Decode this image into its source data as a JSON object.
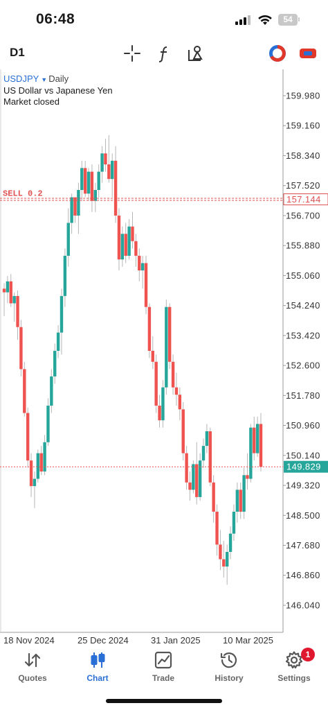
{
  "status_bar": {
    "time": "06:48",
    "battery": "54"
  },
  "toolbar": {
    "timeframe": "D1"
  },
  "chart_info": {
    "symbol": "USDJPY",
    "period": "Daily",
    "description": "US Dollar vs Japanese Yen",
    "market_status": "Market closed"
  },
  "order_line": {
    "label": "SELL 0.2",
    "price": "157.144",
    "value": 157.144
  },
  "current_price": {
    "label": "149.829",
    "value": 149.829
  },
  "bottom_nav": [
    {
      "label": "Quotes",
      "icon": "quotes-arrows-icon"
    },
    {
      "label": "Chart",
      "icon": "candlestick-icon",
      "active": true
    },
    {
      "label": "Trade",
      "icon": "trade-chart-icon"
    },
    {
      "label": "History",
      "icon": "history-clock-icon"
    },
    {
      "label": "Settings",
      "icon": "gear-icon",
      "badge": "1"
    }
  ],
  "colors": {
    "bull": "#26a69a",
    "bear": "#ef5350",
    "accent": "#2a6fd6",
    "order_line": "#e05252",
    "badge": "#e0182f"
  },
  "chart_data": {
    "type": "candlestick",
    "symbol": "USDJPY",
    "timeframe": "Daily",
    "y_ticks": [
      159.98,
      159.16,
      158.34,
      157.52,
      156.7,
      155.88,
      155.06,
      154.24,
      153.42,
      152.6,
      151.78,
      150.96,
      150.14,
      149.32,
      148.5,
      147.68,
      146.86,
      146.04
    ],
    "y_tick_labels": [
      "159.980",
      "159.160",
      "158.340",
      "157.520",
      "156.700",
      "155.880",
      "155.060",
      "154.240",
      "153.420",
      "152.600",
      "151.780",
      "150.960",
      "150.140",
      "149.320",
      "148.500",
      "147.680",
      "146.860",
      "146.040"
    ],
    "x_tick_labels": [
      "18 Nov 2024",
      "25 Dec 2024",
      "31 Jan 2025",
      "10 Mar 2025"
    ],
    "y_range": [
      145.3,
      160.7
    ],
    "candles": [
      [
        154.7,
        154.85,
        153.95,
        154.6
      ],
      [
        154.6,
        155.05,
        154.3,
        154.9
      ],
      [
        154.9,
        155.1,
        154.2,
        154.3
      ],
      [
        154.3,
        154.6,
        153.8,
        154.5
      ],
      [
        154.5,
        154.65,
        153.3,
        153.65
      ],
      [
        153.65,
        153.85,
        152.3,
        152.5
      ],
      [
        152.5,
        152.7,
        151.2,
        151.3
      ],
      [
        151.3,
        151.45,
        149.8,
        150.0
      ],
      [
        150.0,
        150.2,
        149.0,
        149.3
      ],
      [
        149.3,
        149.7,
        148.7,
        149.5
      ],
      [
        149.5,
        150.3,
        149.4,
        150.2
      ],
      [
        150.2,
        150.4,
        149.6,
        149.7
      ],
      [
        149.7,
        150.7,
        149.6,
        150.5
      ],
      [
        150.5,
        151.7,
        150.4,
        151.5
      ],
      [
        151.5,
        152.5,
        151.3,
        152.3
      ],
      [
        152.3,
        153.2,
        152.1,
        153.0
      ],
      [
        153.0,
        153.7,
        152.8,
        153.5
      ],
      [
        153.5,
        154.7,
        152.9,
        154.5
      ],
      [
        154.5,
        155.8,
        154.2,
        155.6
      ],
      [
        155.6,
        156.9,
        155.3,
        156.5
      ],
      [
        156.5,
        157.3,
        156.2,
        157.2
      ],
      [
        157.2,
        157.2,
        156.5,
        156.7
      ],
      [
        156.7,
        157.6,
        156.2,
        157.4
      ],
      [
        157.4,
        158.2,
        157.1,
        158.0
      ],
      [
        158.0,
        158.2,
        157.2,
        157.3
      ],
      [
        157.3,
        158.0,
        157.1,
        157.9
      ],
      [
        157.9,
        158.1,
        156.8,
        157.1
      ],
      [
        157.1,
        157.6,
        156.8,
        157.4
      ],
      [
        157.4,
        158.1,
        157.2,
        157.9
      ],
      [
        157.9,
        158.6,
        157.6,
        158.4
      ],
      [
        158.4,
        158.8,
        157.9,
        158.1
      ],
      [
        158.1,
        158.9,
        157.6,
        157.7
      ],
      [
        157.7,
        158.4,
        157.2,
        158.2
      ],
      [
        158.2,
        158.6,
        156.5,
        156.7
      ],
      [
        156.7,
        156.9,
        155.2,
        155.5
      ],
      [
        155.5,
        156.4,
        155.3,
        156.2
      ],
      [
        156.2,
        156.5,
        155.4,
        155.6
      ],
      [
        155.6,
        156.6,
        155.5,
        156.4
      ],
      [
        156.4,
        156.8,
        155.8,
        156.0
      ],
      [
        156.0,
        156.2,
        155.3,
        155.6
      ],
      [
        155.6,
        155.8,
        154.9,
        155.2
      ],
      [
        155.2,
        155.6,
        154.7,
        155.4
      ],
      [
        155.4,
        155.6,
        154.0,
        154.2
      ],
      [
        154.2,
        154.3,
        152.8,
        153.0
      ],
      [
        153.0,
        153.4,
        152.5,
        152.7
      ],
      [
        152.7,
        152.9,
        151.3,
        151.5
      ],
      [
        151.5,
        151.8,
        150.9,
        151.1
      ],
      [
        151.1,
        152.2,
        150.9,
        152.0
      ],
      [
        152.0,
        154.4,
        151.8,
        154.2
      ],
      [
        154.2,
        154.3,
        152.5,
        152.7
      ],
      [
        152.7,
        152.9,
        151.8,
        152.0
      ],
      [
        152.0,
        152.4,
        151.5,
        151.8
      ],
      [
        151.8,
        152.0,
        151.1,
        151.4
      ],
      [
        151.4,
        151.6,
        150.0,
        150.2
      ],
      [
        150.2,
        150.4,
        149.2,
        149.4
      ],
      [
        149.4,
        149.7,
        148.9,
        149.2
      ],
      [
        149.2,
        150.0,
        149.1,
        149.9
      ],
      [
        149.9,
        150.5,
        148.8,
        149.0
      ],
      [
        149.0,
        150.2,
        148.9,
        150.0
      ],
      [
        150.0,
        150.6,
        149.8,
        150.4
      ],
      [
        150.4,
        151.0,
        150.2,
        150.8
      ],
      [
        150.8,
        150.9,
        149.3,
        149.4
      ],
      [
        149.4,
        149.6,
        148.3,
        148.6
      ],
      [
        148.6,
        148.8,
        147.4,
        147.7
      ],
      [
        147.7,
        148.1,
        147.0,
        147.3
      ],
      [
        147.3,
        147.8,
        146.8,
        147.1
      ],
      [
        147.1,
        147.7,
        146.6,
        147.5
      ],
      [
        147.5,
        148.2,
        147.3,
        148.0
      ],
      [
        148.0,
        148.8,
        147.8,
        148.6
      ],
      [
        148.6,
        149.4,
        148.3,
        149.2
      ],
      [
        149.2,
        149.4,
        148.4,
        148.6
      ],
      [
        148.6,
        149.8,
        148.4,
        149.6
      ],
      [
        149.6,
        150.2,
        149.2,
        149.5
      ],
      [
        149.5,
        151.0,
        149.4,
        150.9
      ],
      [
        150.9,
        151.2,
        150.0,
        150.2
      ],
      [
        150.2,
        151.2,
        150.1,
        151.0
      ],
      [
        151.0,
        151.3,
        149.7,
        149.83
      ]
    ]
  }
}
